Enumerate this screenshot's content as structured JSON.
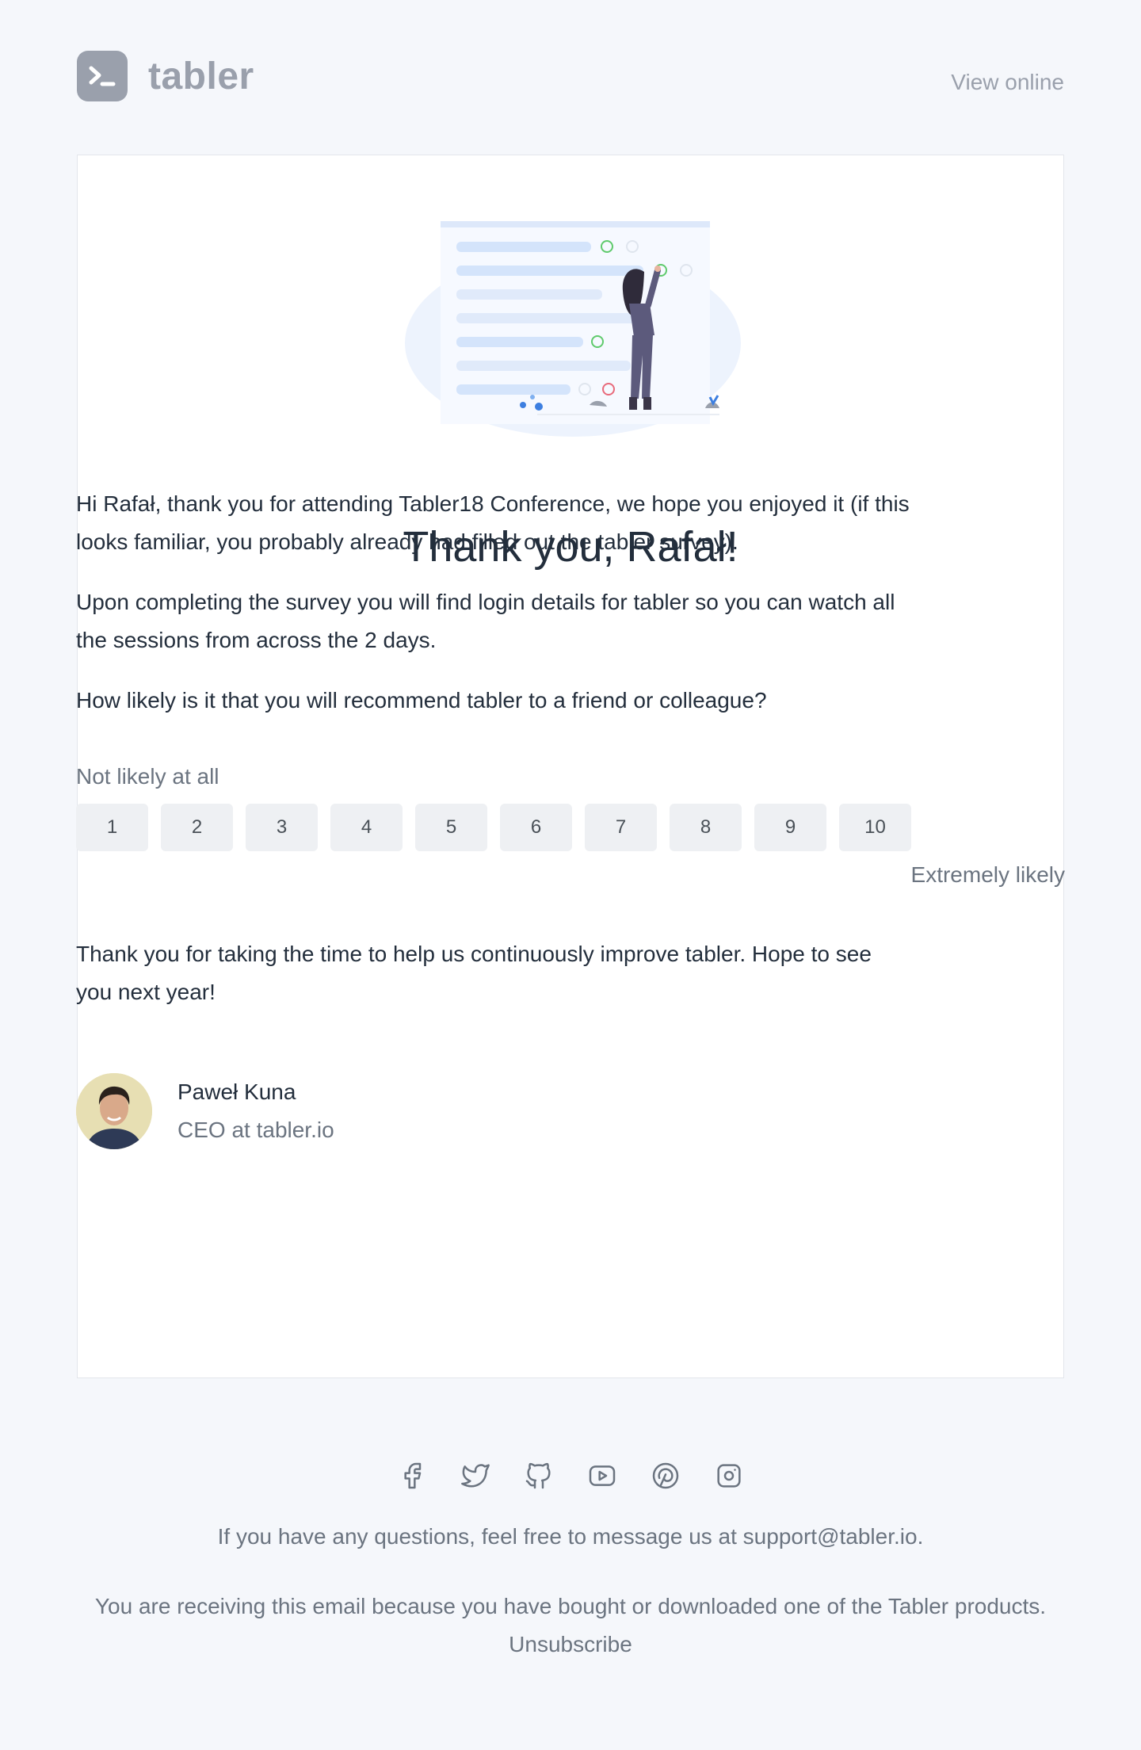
{
  "header": {
    "brand": "tabler",
    "view_online": "View online"
  },
  "hero": {
    "image": "survey-illustration"
  },
  "main": {
    "title": "Thank you, Rafał!",
    "paragraph1": "Hi Rafał, thank you for attending Tabler18 Conference, we hope you enjoyed it (if this looks familiar, you probably already had filled out the tabler survey).",
    "paragraph2": "Upon completing the survey you will find login details for tabler so you can watch all the sessions from across the 2 days.",
    "question": "How likely is it that you will recommend tabler to a friend or colleague?",
    "scale_low": "Not likely at all",
    "scale_high": "Extremely likely",
    "scale": [
      "1",
      "2",
      "3",
      "4",
      "5",
      "6",
      "7",
      "8",
      "9",
      "10"
    ],
    "closing": "Thank you for taking the time to help us continuously improve tabler. Hope to see you next year!"
  },
  "signature": {
    "name": "Paweł Kuna",
    "role": "CEO at tabler.io"
  },
  "footer": {
    "social_icons": [
      "facebook-icon",
      "twitter-icon",
      "github-icon",
      "youtube-icon",
      "pinterest-icon",
      "instagram-icon"
    ],
    "questions": "If you have any questions, feel free to message us at support@tabler.io.",
    "receiving": "You are receiving this email because you have bought or downloaded one of the Tabler products.",
    "unsubscribe": "Unsubscribe"
  },
  "colors": {
    "background": "#f5f7fb",
    "muted": "#9aa0ac",
    "text": "#232e3c",
    "accent": "#d4e4fb"
  }
}
